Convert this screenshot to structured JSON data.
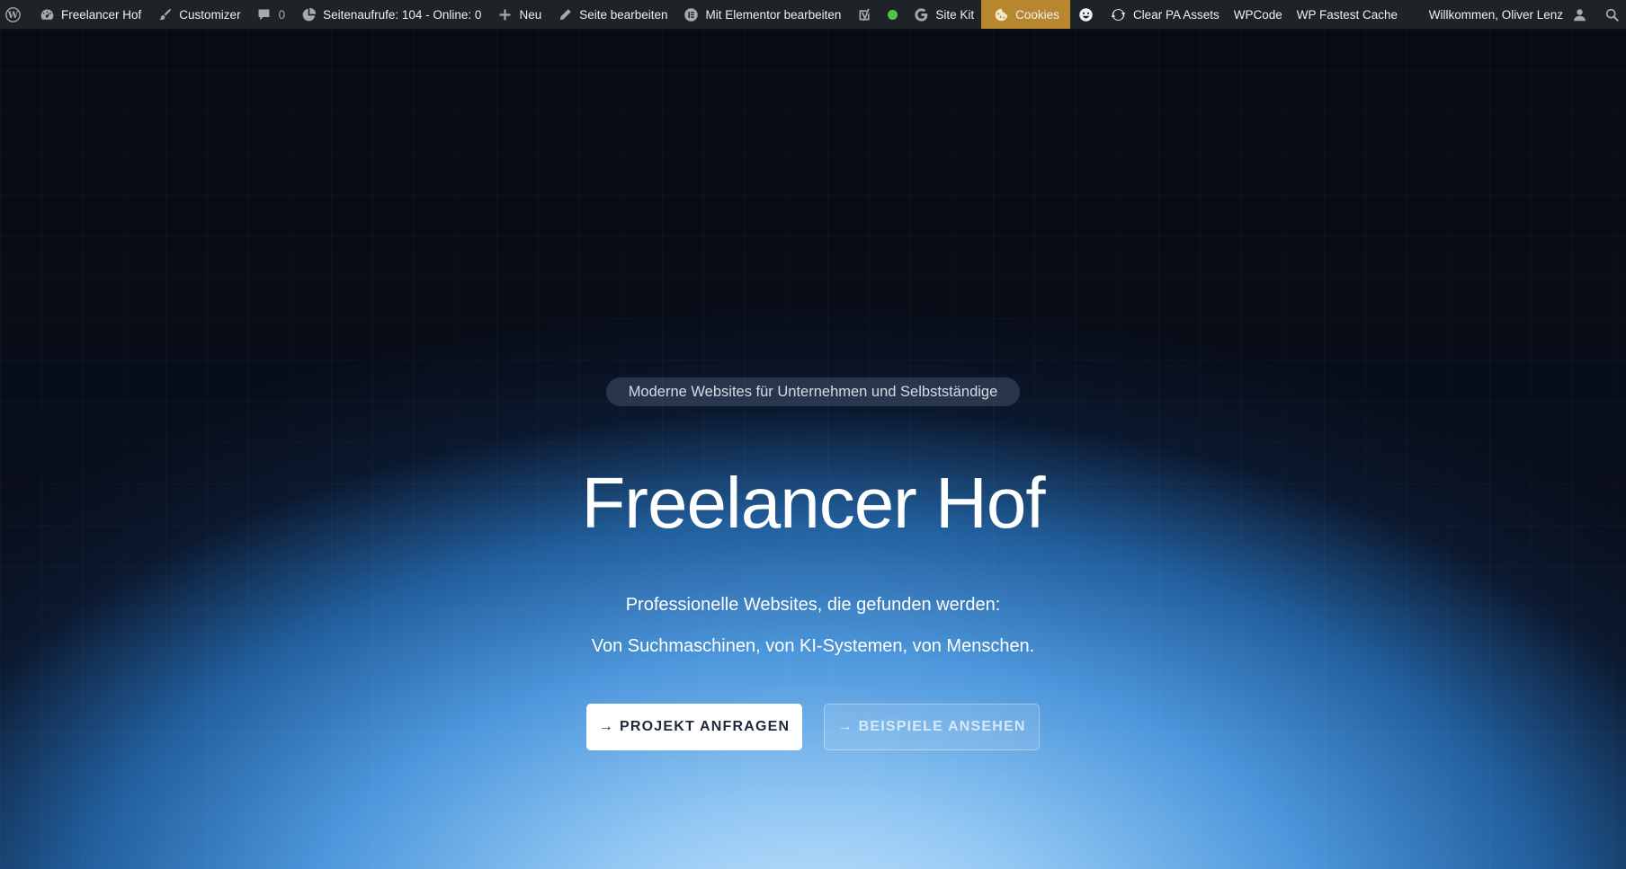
{
  "adminbar": {
    "site_name": "Freelancer Hof",
    "customizer": "Customizer",
    "comments_count": "0",
    "pageviews": "Seitenaufrufe: 104 - Online: 0",
    "new": "Neu",
    "edit_page": "Seite bearbeiten",
    "edit_elementor": "Mit Elementor bearbeiten",
    "site_kit": "Site Kit",
    "cookies": "Cookies",
    "clear_pa_assets": "Clear PA Assets",
    "wpcode": "WPCode",
    "wp_fastest_cache": "WP Fastest Cache",
    "welcome": "Willkommen, Oliver Lenz",
    "seo_status_color": "#54c24a",
    "cookies_color": "#b8862f"
  },
  "hero": {
    "tagline": "Moderne Websites für Unternehmen und Selbstständige",
    "title": "Freelancer Hof",
    "subtitle_line1": "Professionelle Websites, die gefunden werden:",
    "subtitle_line2": "Von Suchmaschinen, von KI-Systemen, von Menschen.",
    "cta_primary": "PROJEKT ANFRAGEN",
    "cta_secondary": "BEISPIELE ANSEHEN",
    "arrow_glyph": "→"
  }
}
